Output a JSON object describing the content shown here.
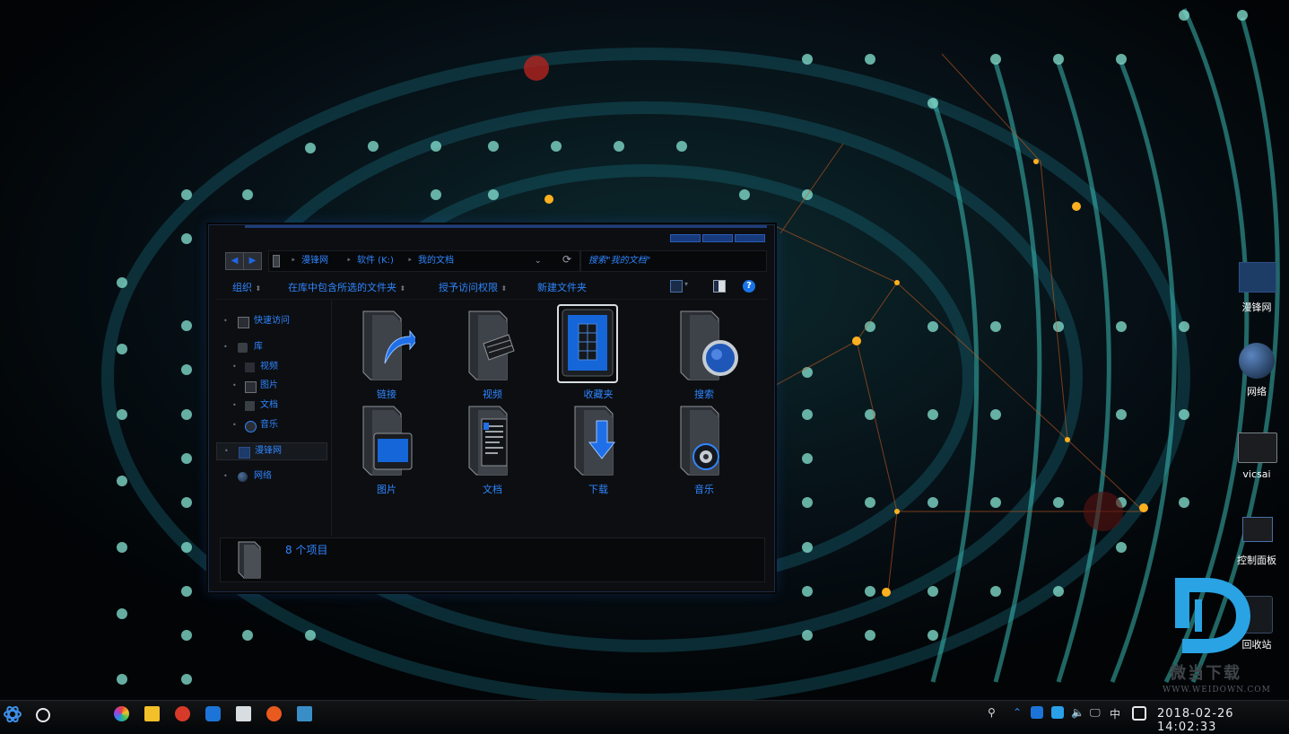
{
  "explorer": {
    "address": {
      "crumbs": [
        "漫锋网",
        "软件 (K:)",
        "我的文档"
      ]
    },
    "search": {
      "placeholder": "搜索\"我的文档\""
    },
    "toolbar": {
      "organize": "组织",
      "include_in_library": "在库中包含所选的文件夹",
      "share": "授予访问权限",
      "new_folder": "新建文件夹",
      "help": "?"
    },
    "sidebar": {
      "quick_access": "快速访问",
      "library": "库",
      "videos": "视频",
      "pictures": "图片",
      "documents": "文档",
      "music": "音乐",
      "manfeng": "漫锋网",
      "network": "网络"
    },
    "items": [
      {
        "label": "链接",
        "icon": "links-folder-icon"
      },
      {
        "label": "视频",
        "icon": "videos-folder-icon"
      },
      {
        "label": "收藏夹",
        "icon": "favorites-folder-icon",
        "selected": true
      },
      {
        "label": "搜索",
        "icon": "searches-folder-icon"
      },
      {
        "label": "图片",
        "icon": "pictures-folder-icon"
      },
      {
        "label": "文档",
        "icon": "documents-folder-icon"
      },
      {
        "label": "下载",
        "icon": "downloads-folder-icon"
      },
      {
        "label": "音乐",
        "icon": "music-folder-icon"
      }
    ],
    "details": {
      "item_count": "8 个项目"
    }
  },
  "desktop": {
    "icons": [
      {
        "label": "漫锋网",
        "icon": "monitor-icon"
      },
      {
        "label": "网络",
        "icon": "globe-icon"
      },
      {
        "label": "vicsai",
        "icon": "folder-icon"
      },
      {
        "label": "控制面板",
        "icon": "control-panel-icon"
      },
      {
        "label": "回收站",
        "icon": "recycle-bin-icon"
      }
    ]
  },
  "watermark": {
    "brand": "微当下载",
    "url": "WWW.WEIDOWN.COM"
  },
  "taskbar": {
    "ime": "中",
    "datetime": "2018-02-26  14:02:33"
  },
  "colors": {
    "accent": "#2f86ff",
    "window_bg": "#0c0e11",
    "taskbar_bg": "#0b0c0e"
  }
}
